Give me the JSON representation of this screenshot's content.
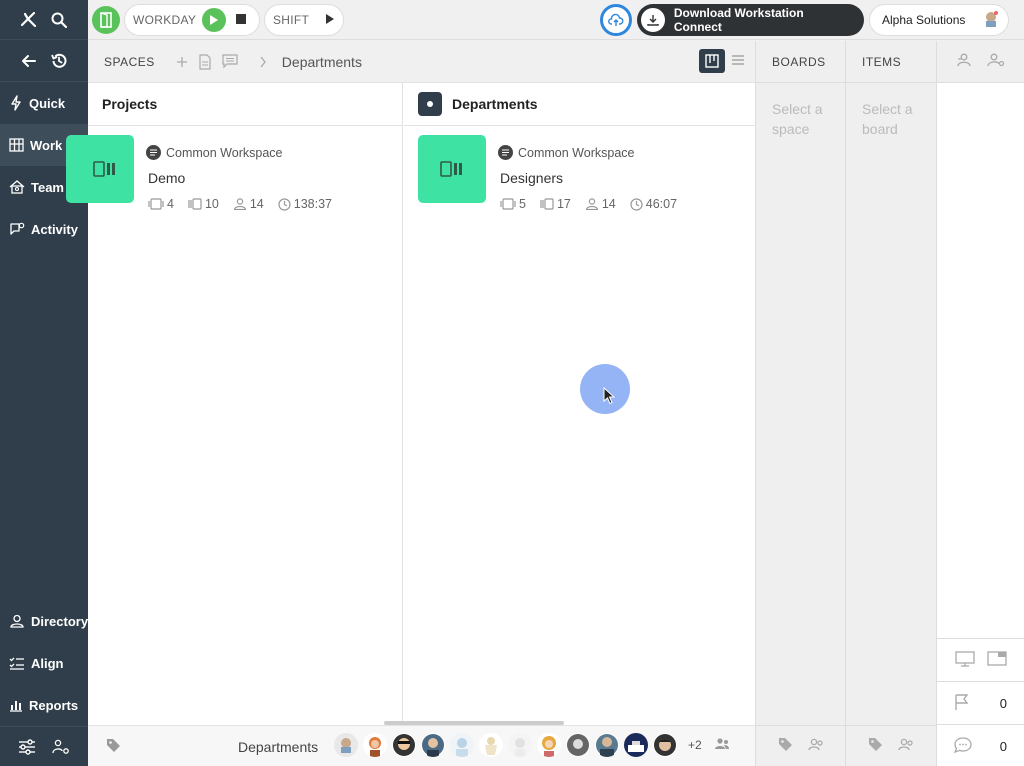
{
  "sidebar": {
    "items": [
      {
        "label": "Quick",
        "icon": "bolt-icon"
      },
      {
        "label": "Work",
        "icon": "board-icon"
      },
      {
        "label": "Team",
        "icon": "team-icon"
      },
      {
        "label": "Activity",
        "icon": "activity-icon"
      }
    ],
    "bottom_items": [
      {
        "label": "Directory",
        "icon": "directory-icon"
      },
      {
        "label": "Align",
        "icon": "align-icon"
      },
      {
        "label": "Reports",
        "icon": "reports-icon"
      }
    ],
    "active": "Work"
  },
  "topbar": {
    "workday_label": "WORKDAY",
    "shift_label": "SHIFT",
    "download_label": "Download Workstation Connect",
    "org_name": "Alpha Solutions"
  },
  "toolbar": {
    "spaces_label": "SPACES",
    "breadcrumb": "Departments"
  },
  "columns": {
    "projects": {
      "title": "Projects",
      "card": {
        "workspace": "Common Workspace",
        "name": "Demo",
        "boards": "4",
        "items": "10",
        "members": "14",
        "time": "138:37"
      }
    },
    "departments": {
      "title": "Departments",
      "card": {
        "workspace": "Common Workspace",
        "name": "Designers",
        "boards": "5",
        "items": "17",
        "members": "14",
        "time": "46:07"
      }
    }
  },
  "bottombar": {
    "label": "Departments",
    "more_count": "+2"
  },
  "boards_panel": {
    "title": "BOARDS",
    "hint": "Select a space"
  },
  "items_panel": {
    "title": "ITEMS",
    "hint": "Select a board"
  },
  "rail": {
    "flags_count": "0",
    "comments_count": "0"
  },
  "colors": {
    "sidebar_bg": "#2f3e4a",
    "accent_green": "#5ac25a",
    "thumb_green": "#3ee3a3",
    "cloud_blue": "#2e86de",
    "cursor_blue": "#94b4f5"
  }
}
